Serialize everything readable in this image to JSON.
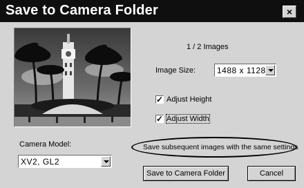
{
  "window": {
    "title": "Save to Camera Folder",
    "close_glyph": "×"
  },
  "image_count": "1 / 2 Images",
  "image_size": {
    "label": "Image Size:",
    "value": "1488 x 1128"
  },
  "checkboxes": [
    {
      "label": "Adjust Height",
      "checked": true
    },
    {
      "label": "Adjust Width",
      "checked": true
    }
  ],
  "camera_model": {
    "label": "Camera Model:",
    "value": "XV2, GL2"
  },
  "buttons": {
    "save_subsequent": "Save subsequent images with the same settings",
    "save": "Save to Camera Folder",
    "cancel": "Cancel"
  },
  "icons": {
    "dropdown": "chevron-down-icon",
    "check": "checkmark-icon",
    "close": "close-icon"
  }
}
